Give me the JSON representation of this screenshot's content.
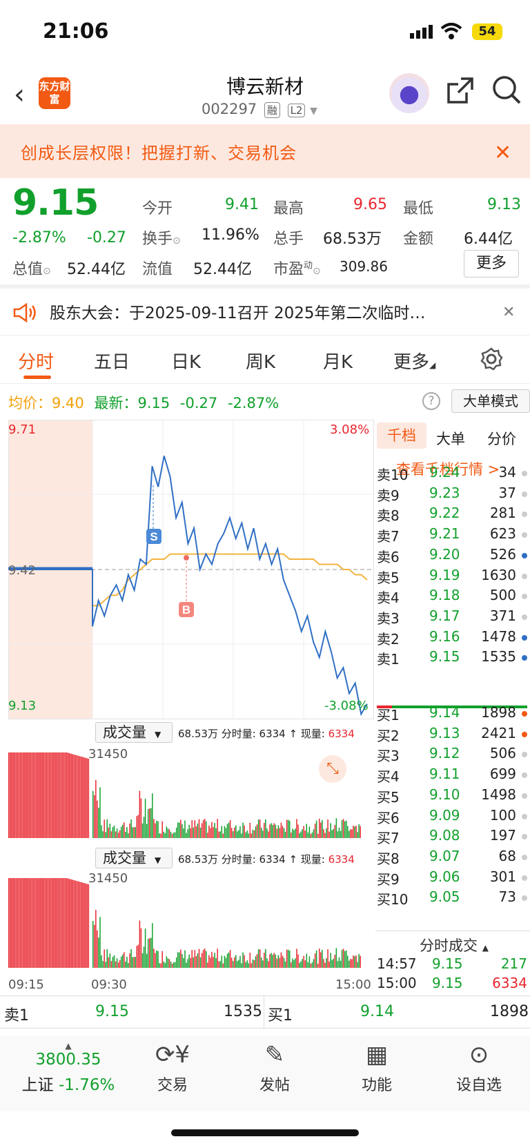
{
  "status": {
    "time": "21:06",
    "battery": "54"
  },
  "header": {
    "logo": "东方财富",
    "title": "博云新材",
    "code": "002297",
    "tags": [
      "融",
      "L2"
    ]
  },
  "banner": {
    "text": "创成长层权限！把握打新、交易机会"
  },
  "quote": {
    "price": "9.15",
    "pct": "-2.87%",
    "chg": "-0.27",
    "open_label": "今开",
    "open": "9.41",
    "high_label": "最高",
    "high": "9.65",
    "low_label": "最低",
    "low": "9.13",
    "turnover_label": "换手",
    "turnover": "11.96%",
    "vol_label": "总手",
    "vol": "68.53万",
    "amount_label": "金额",
    "amount": "6.44亿",
    "mcap_label": "总值",
    "mcap": "52.44亿",
    "float_label": "流值",
    "float": "52.44亿",
    "pe_label": "市盈",
    "pe_sup": "动",
    "pe": "309.86",
    "more": "更多"
  },
  "notice": {
    "text": "股东大会：于2025-09-11召开 2025年第二次临时…"
  },
  "tabs": [
    "分时",
    "五日",
    "日K",
    "周K",
    "月K",
    "更多"
  ],
  "avg": {
    "avg_label": "均价：",
    "avg": "9.40",
    "latest_label": "最新：",
    "latest": "9.15",
    "chg": "-0.27",
    "pct": "-2.87%",
    "mode_btn": "大单模式"
  },
  "chart_data": {
    "type": "line",
    "y_max": "9.71",
    "y_min": "9.13",
    "pre_close": "9.42",
    "pct_max": "3.08%",
    "pct_min": "-3.08%",
    "x_ticks": [
      "09:15",
      "09:30",
      "15:00"
    ],
    "markers": [
      "S",
      "B"
    ],
    "price": [
      9.42,
      9.42,
      9.42,
      9.31,
      9.36,
      9.33,
      9.37,
      9.39,
      9.36,
      9.41,
      9.38,
      9.44,
      9.43,
      9.62,
      9.58,
      9.64,
      9.6,
      9.52,
      9.55,
      9.47,
      9.5,
      9.42,
      9.45,
      9.43,
      9.47,
      9.49,
      9.52,
      9.48,
      9.51,
      9.46,
      9.5,
      9.44,
      9.47,
      9.43,
      9.46,
      9.4,
      9.37,
      9.34,
      9.3,
      9.33,
      9.28,
      9.25,
      9.3,
      9.26,
      9.21,
      9.23,
      9.18,
      9.2,
      9.14,
      9.16
    ],
    "avg": [
      9.42,
      9.42,
      9.42,
      9.35,
      9.35,
      9.36,
      9.37,
      9.37,
      9.38,
      9.4,
      9.41,
      9.42,
      9.43,
      9.44,
      9.44,
      9.44,
      9.45,
      9.45,
      9.45,
      9.45,
      9.45,
      9.45,
      9.45,
      9.45,
      9.45,
      9.45,
      9.45,
      9.45,
      9.45,
      9.45,
      9.45,
      9.45,
      9.45,
      9.45,
      9.45,
      9.45,
      9.44,
      9.44,
      9.44,
      9.44,
      9.44,
      9.43,
      9.43,
      9.43,
      9.43,
      9.42,
      9.42,
      9.41,
      9.41,
      9.4
    ]
  },
  "vol1": {
    "label": "成交量",
    "info": "68.53万 分时量: 6334 ↑ 现量:",
    "now": "6334",
    "max": "31450"
  },
  "vol2": {
    "label": "成交量",
    "info": "68.53万 分时量: 6334 ↑ 现量:",
    "now": "6334",
    "max": "31450"
  },
  "orderbook": {
    "tabs": [
      "千档",
      "大单",
      "分价"
    ],
    "link": "查看千档行情 >",
    "asks": [
      [
        "卖10",
        "9.24",
        "34"
      ],
      [
        "卖9",
        "9.23",
        "37"
      ],
      [
        "卖8",
        "9.22",
        "281"
      ],
      [
        "卖7",
        "9.21",
        "623"
      ],
      [
        "卖6",
        "9.20",
        "526"
      ],
      [
        "卖5",
        "9.19",
        "1630"
      ],
      [
        "卖4",
        "9.18",
        "500"
      ],
      [
        "卖3",
        "9.17",
        "371"
      ],
      [
        "卖2",
        "9.16",
        "1478"
      ],
      [
        "卖1",
        "9.15",
        "1535"
      ]
    ],
    "bids": [
      [
        "买1",
        "9.14",
        "1898"
      ],
      [
        "买2",
        "9.13",
        "2421"
      ],
      [
        "买3",
        "9.12",
        "506"
      ],
      [
        "买4",
        "9.11",
        "699"
      ],
      [
        "买5",
        "9.10",
        "1498"
      ],
      [
        "买6",
        "9.09",
        "100"
      ],
      [
        "买7",
        "9.08",
        "197"
      ],
      [
        "买8",
        "9.07",
        "68"
      ],
      [
        "买9",
        "9.06",
        "301"
      ],
      [
        "买10",
        "9.05",
        "73"
      ]
    ],
    "ticks_title": "分时成交",
    "ticks": [
      [
        "14:57",
        "9.15",
        "217"
      ],
      [
        "15:00",
        "9.15",
        "6334"
      ]
    ]
  },
  "bottom": {
    "ask_label": "卖1",
    "ask_price": "9.15",
    "ask_vol": "1535",
    "bid_label": "买1",
    "bid_price": "9.14",
    "bid_vol": "1898"
  },
  "nav": {
    "index_value": "3800.35",
    "index_name": "上证",
    "index_pct": "-1.76%",
    "items": [
      "交易",
      "发帖",
      "功能",
      "设自选"
    ]
  }
}
